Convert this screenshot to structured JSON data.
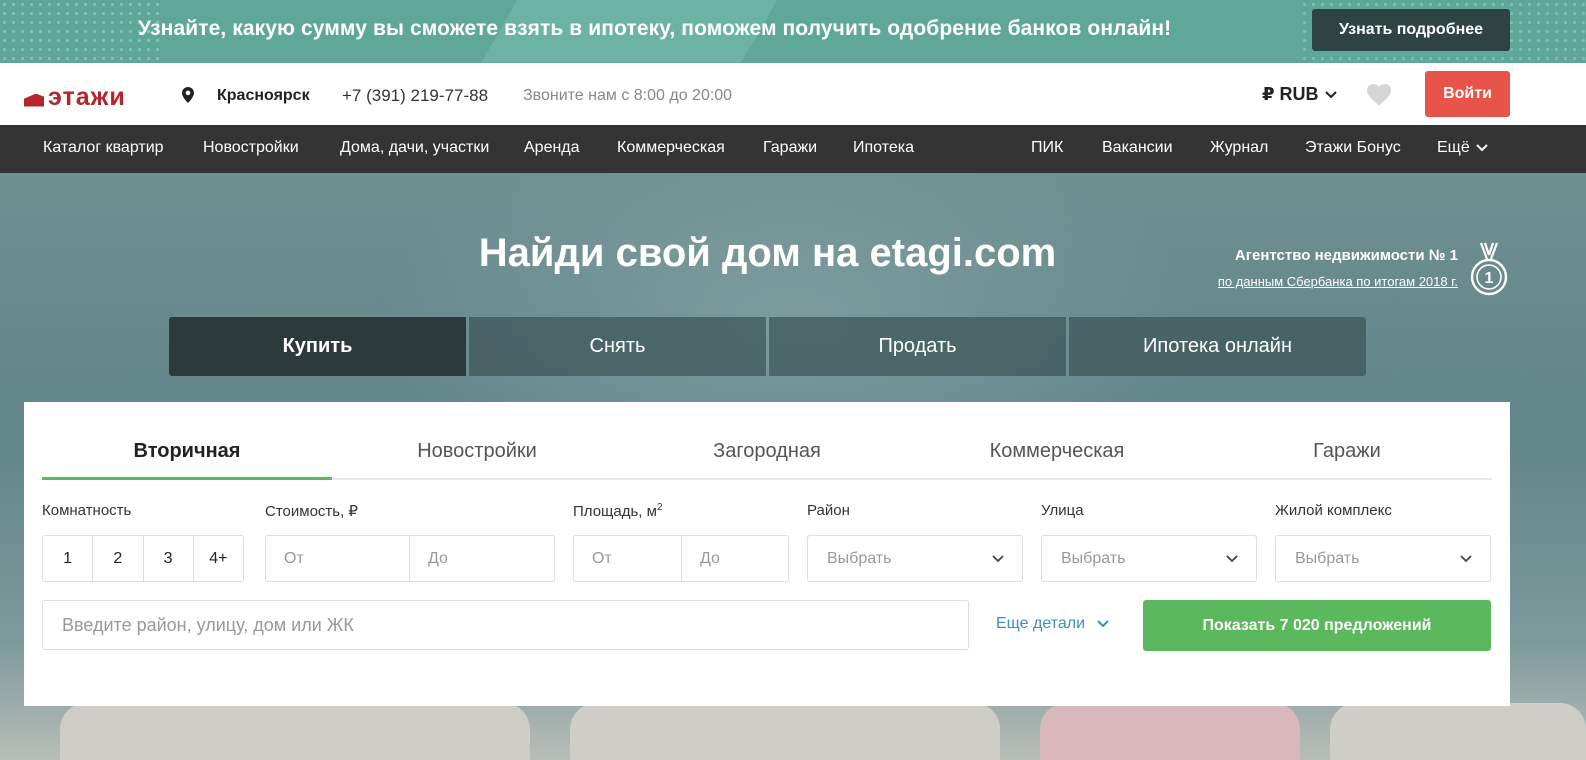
{
  "promo": {
    "text": "Узнайте, какую сумму вы сможете взять в ипотеку, поможем получить одобрение банков онлайн!",
    "button_label": "Узнать подробнее"
  },
  "header": {
    "logo_text": "этажи",
    "city": "Красноярск",
    "phone": "+7 (391) 219-77-88",
    "hours": "Звоните нам с 8:00 до 20:00",
    "currency": "₽ RUB",
    "login_label": "Войти"
  },
  "nav": {
    "left_items": [
      "Каталог квартир",
      "Новостройки",
      "Дома, дачи, участки",
      "Аренда",
      "Коммерческая",
      "Гаражи",
      "Ипотека"
    ],
    "right_items": [
      "ПИК",
      "Вакансии",
      "Журнал",
      "Этажи Бонус"
    ],
    "more_label": "Ещё"
  },
  "hero": {
    "title": "Найди свой дом на etagi.com",
    "agency_title": "Агентство недвижимости № 1",
    "agency_link": "по данным Сбербанка по итогам 2018 г.",
    "medal_number": "1",
    "mode_tabs": [
      "Купить",
      "Снять",
      "Продать",
      "Ипотека онлайн"
    ],
    "active_mode": "Купить"
  },
  "search": {
    "type_tabs": [
      "Вторичная",
      "Новостройки",
      "Загородная",
      "Коммерческая",
      "Гаражи"
    ],
    "active_type": "Вторичная",
    "labels": {
      "rooms": "Комнатность",
      "price": "Стоимость, ₽",
      "area": "Площадь, м",
      "area_sup": "2",
      "district": "Район",
      "street": "Улица",
      "complex": "Жилой комплекс"
    },
    "rooms": [
      "1",
      "2",
      "3",
      "4+"
    ],
    "price_from_placeholder": "От",
    "price_to_placeholder": "До",
    "area_from_placeholder": "От",
    "area_to_placeholder": "До",
    "district_value": "Выбрать",
    "street_value": "Выбрать",
    "complex_value": "Выбрать",
    "query_placeholder": "Введите район, улицу, дом или ЖК",
    "more_details": "Еще детали",
    "show_button": "Показать 7 020 предложений"
  },
  "colors": {
    "promo_bg": "#5fa898",
    "brand_red": "#b3262c",
    "login": "#e8544a",
    "nav_bg": "#343434",
    "accent_green": "#5cb85c",
    "link_blue": "#3b8fc4"
  },
  "icons": {
    "pin": "map-pin-icon",
    "heart": "heart-icon",
    "medal": "medal-icon",
    "chevron": "chevron-down-icon"
  }
}
